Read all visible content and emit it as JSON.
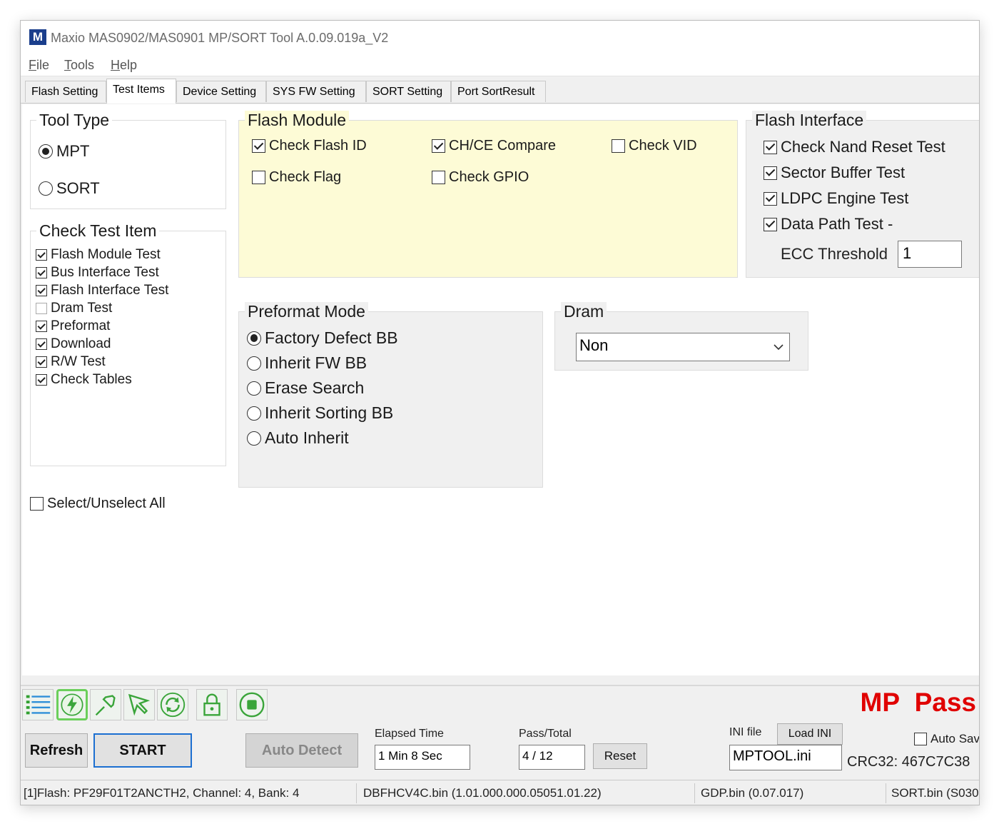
{
  "window": {
    "icon_letter": "M",
    "title": "Maxio MAS0902/MAS0901 MP/SORT Tool A.0.09.019a_V2"
  },
  "menu": [
    {
      "accel": "F",
      "rest": "ile"
    },
    {
      "accel": "T",
      "rest": "ools"
    },
    {
      "accel": "H",
      "rest": "elp"
    }
  ],
  "tabs": [
    "Flash Setting",
    "Test Items",
    "Device Setting",
    "SYS FW Setting",
    "SORT Setting",
    "Port SortResult"
  ],
  "active_tab": "Test Items",
  "tool_type": {
    "label": "Tool Type",
    "options": [
      {
        "label": "MPT",
        "checked": true
      },
      {
        "label": "SORT",
        "checked": false
      }
    ]
  },
  "check_test_item": {
    "label": "Check Test Item",
    "items": [
      {
        "label": "Flash Module Test",
        "checked": true
      },
      {
        "label": "Bus Interface Test",
        "checked": true
      },
      {
        "label": "Flash Interface Test",
        "checked": true
      },
      {
        "label": "Dram Test",
        "checked": false
      },
      {
        "label": "Preformat",
        "checked": true
      },
      {
        "label": "Download",
        "checked": true
      },
      {
        "label": "R/W Test",
        "checked": true
      },
      {
        "label": "Check Tables",
        "checked": true
      }
    ]
  },
  "select_all": {
    "label": "Select/Unselect All",
    "checked": false
  },
  "flash_module": {
    "label": "Flash Module",
    "items": [
      {
        "label": "Check Flash ID",
        "checked": true
      },
      {
        "label": "CH/CE Compare",
        "checked": true
      },
      {
        "label": "Check VID",
        "checked": false
      },
      {
        "label": "Check Flag",
        "checked": false
      },
      {
        "label": "Check GPIO",
        "checked": false
      }
    ]
  },
  "flash_interface": {
    "label": "Flash Interface",
    "items": [
      {
        "label": "Check Nand Reset Test",
        "checked": true
      },
      {
        "label": "Sector Buffer Test",
        "checked": true
      },
      {
        "label": "LDPC Engine Test",
        "checked": true
      },
      {
        "label": "Data Path Test -",
        "checked": true
      }
    ],
    "ecc_label": "ECC Threshold",
    "ecc_value": "1"
  },
  "preformat_mode": {
    "label": "Preformat Mode",
    "options": [
      {
        "label": "Factory Defect BB",
        "checked": true
      },
      {
        "label": "Inherit FW BB",
        "checked": false
      },
      {
        "label": "Erase Search",
        "checked": false
      },
      {
        "label": "Inherit Sorting BB",
        "checked": false
      },
      {
        "label": "Auto Inherit",
        "checked": false
      }
    ]
  },
  "dram": {
    "label": "Dram",
    "selected": "Non"
  },
  "toolbar": {
    "icons": [
      "list-icon",
      "lightning-icon",
      "pin-icon",
      "cursor-arrow-icon",
      "refresh-cycle-icon",
      "lock-icon",
      "stop-icon"
    ],
    "result_text_1": "MP",
    "result_text_2": "Pass",
    "result_color": "#e00000"
  },
  "controls": {
    "refresh_label": "Refresh",
    "start_label": "START",
    "auto_detect_label": "Auto Detect",
    "elapsed_label": "Elapsed Time",
    "elapsed_value": "1 Min 8 Sec",
    "pass_total_label": "Pass/Total",
    "pass_total_value": "4 / 12",
    "reset_label": "Reset",
    "ini_label": "INI file",
    "load_ini_label": "Load INI",
    "ini_value": "MPTOOL.ini",
    "auto_save_label": "Auto Sav",
    "auto_save_checked": false,
    "crc_label": "CRC32: 467C7C38"
  },
  "status_bar": [
    "[1]Flash: PF29F01T2ANCTH2, Channel: 4, Bank: 4",
    "DBFHCV4C.bin (1.01.000.000.05051.01.22)",
    "GDP.bin (0.07.017)",
    "SORT.bin (S030"
  ],
  "colors": {
    "flash_module_bg": "#fdfbd6",
    "start_border": "#1c6fd1",
    "toolbar_green": "#3aa53a"
  }
}
